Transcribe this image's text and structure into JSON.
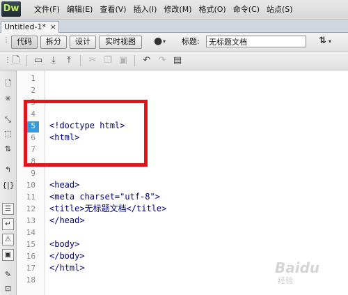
{
  "app": {
    "logo": "Dw"
  },
  "menu": [
    "文件(F)",
    "编辑(E)",
    "查看(V)",
    "插入(I)",
    "修改(M)",
    "格式(O)",
    "命令(C)",
    "站点(S)"
  ],
  "tab": {
    "name": "Untitled-1*",
    "close": "×"
  },
  "doc_toolbar": {
    "views": [
      "代码",
      "拆分",
      "设计",
      "实时视图"
    ],
    "title_label": "标题:",
    "title_value": "无标题文档"
  },
  "code": {
    "current_line": 5,
    "lines": [
      "",
      "",
      "",
      "",
      "<!doctype html>",
      "<html>",
      "",
      "",
      "",
      "<head>",
      "<meta charset=\"utf-8\">",
      "<title>无标题文档</title>",
      "</head>",
      "",
      "<body>",
      "</body>",
      "</html>",
      ""
    ],
    "line_numbers": [
      "1",
      "2",
      "3",
      "4",
      "5",
      "6",
      "7",
      "8",
      "9",
      "10",
      "11",
      "12",
      "13",
      "14",
      "15",
      "16",
      "17",
      "18"
    ]
  },
  "watermark": {
    "main": "Baidu",
    "sub": "经验"
  },
  "colors": {
    "accent": "#3a9ad9",
    "highlight": "#e0161b",
    "code_text": "#000080"
  }
}
